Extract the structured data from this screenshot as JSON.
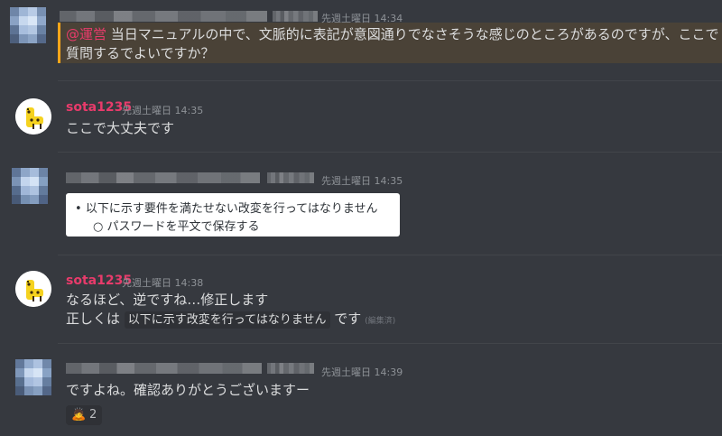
{
  "messages": [
    {
      "timestamp": "先週土曜日 14:34",
      "mention": "@運営",
      "text_line1": " 当日マニュアルの中で、文脈的に表記が意図通りでなさそうな感じのところがあるのですが、ここで",
      "text_line2": "質問するでよいですか？"
    },
    {
      "username": "sota1235",
      "timestamp": "先週土曜日 14:35",
      "text": "ここで大丈夫です"
    },
    {
      "timestamp": "先週土曜日 14:35",
      "card": {
        "bullet": "以下に示す要件を満たせない改変を行ってはなりません",
        "sub_bullet": "パスワードを平文で保存する"
      }
    },
    {
      "username": "sota1235",
      "timestamp": "先週土曜日 14:38",
      "line1": "なるほど、逆ですね…修正します",
      "line2_prefix": "正しくは",
      "line2_code": "以下に示す改変を行ってはなりません",
      "line2_suffix": "です",
      "edited": "(編集済)"
    },
    {
      "timestamp": "先週土曜日 14:39",
      "text": "ですよね。確認ありがとうございますー",
      "reaction": {
        "emoji": "🙇",
        "count": "2"
      }
    }
  ],
  "colors": {
    "background": "#36393f",
    "username": "#e83b6b",
    "mention_highlight": "#4a4237",
    "mention_bar": "#faa61a"
  }
}
